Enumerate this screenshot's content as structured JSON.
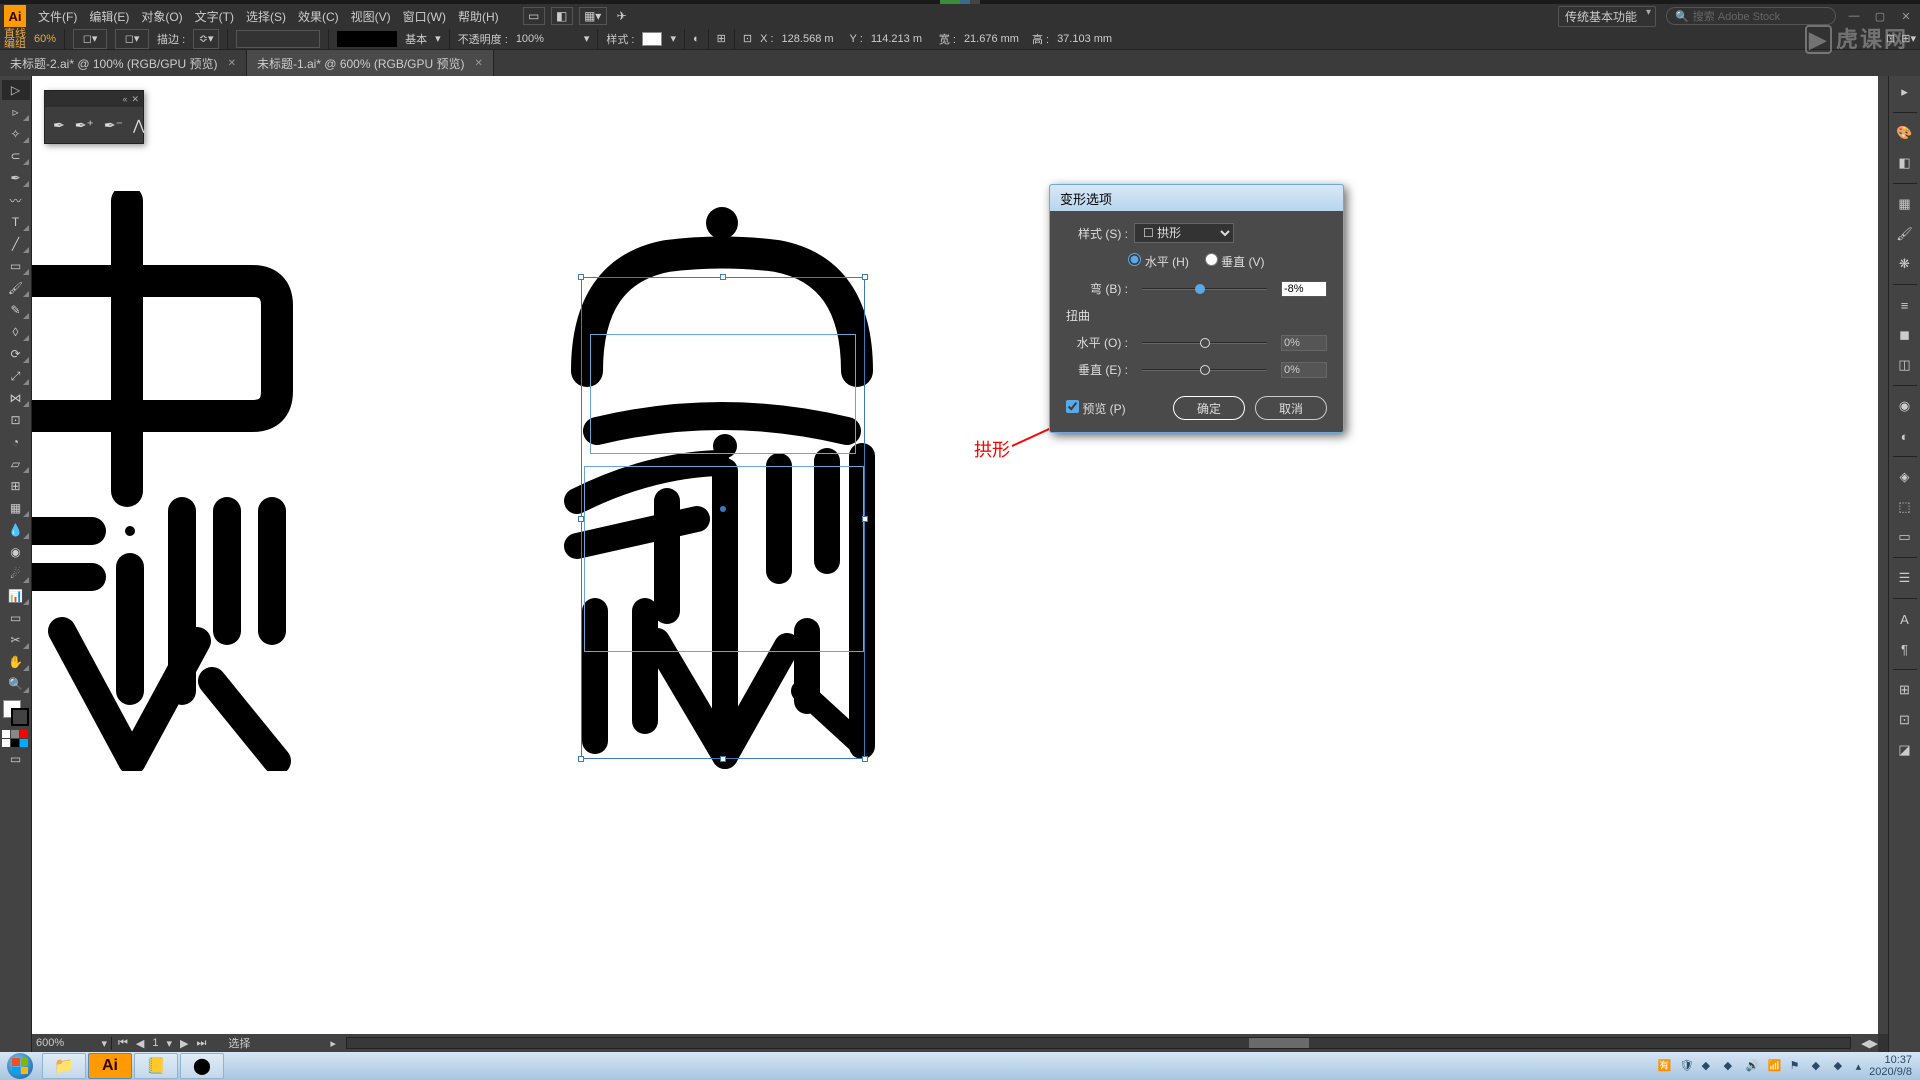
{
  "app_icon": "Ai",
  "menubar": {
    "items": [
      "文件(F)",
      "编辑(E)",
      "对象(O)",
      "文字(T)",
      "选择(S)",
      "效果(C)",
      "视图(V)",
      "窗口(W)",
      "帮助(H)"
    ],
    "search_placeholder": "搜索 Adobe Stock",
    "workspace": "传统基本功能"
  },
  "control": {
    "label_top": "直线",
    "label_bot": "编组",
    "anchor": "描边 :",
    "stroke_val": " ",
    "stroke_style": "基本",
    "opacity_lbl": "不透明度 :",
    "opacity_val": "100%",
    "style_lbl": "样式 :",
    "x_lbl": "X :",
    "x_val": "128.568 m",
    "y_lbl": "Y :",
    "y_val": "114.213 m",
    "w_lbl": "宽 :",
    "w_val": "21.676 mm",
    "h_lbl": "高 :",
    "h_val": "37.103 mm"
  },
  "tabs": [
    {
      "label": "未标题-2.ai* @ 100% (RGB/GPU 预览)",
      "active": false
    },
    {
      "label": "未标题-1.ai* @ 600% (RGB/GPU 预览)",
      "active": true
    }
  ],
  "statusbar": {
    "zoom": "600%",
    "artboard_nav": "1",
    "status": "选择"
  },
  "dialog": {
    "title": "变形选项",
    "style_lbl": "样式 (S) :",
    "style_val": "☐ 拱形",
    "horiz": "水平 (H)",
    "vert": "垂直 (V)",
    "bend_lbl": "弯 (B) :",
    "bend_val": "-8%",
    "distort_hdr": "扭曲",
    "dist_h_lbl": "水平 (O) :",
    "dist_h_val": "0%",
    "dist_v_lbl": "垂直 (E) :",
    "dist_v_val": "0%",
    "preview": "预览 (P)",
    "ok": "确定",
    "cancel": "取消"
  },
  "annotation": "拱形",
  "taskbar": {
    "time": "10:37",
    "date": "2020/9/8"
  },
  "watermark": "虎课网",
  "brush_percent": "60%"
}
